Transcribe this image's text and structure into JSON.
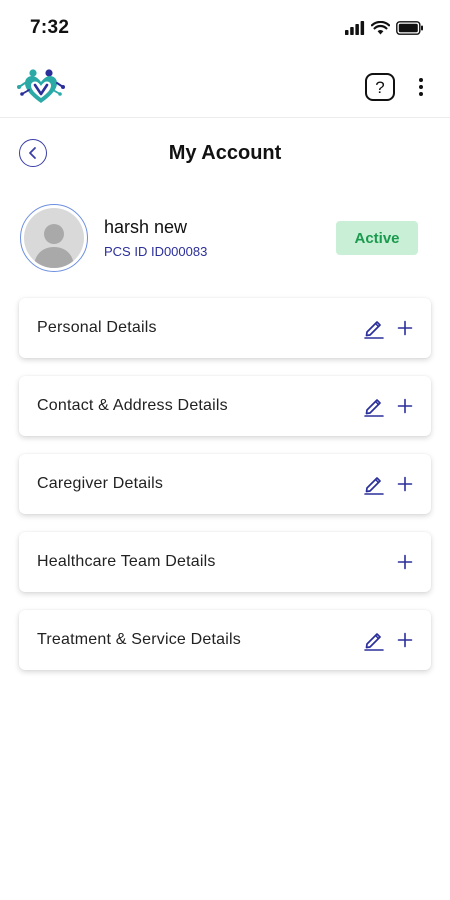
{
  "status_bar": {
    "time": "7:32"
  },
  "header": {
    "help_symbol": "?"
  },
  "page": {
    "title": "My Account"
  },
  "profile": {
    "name": "harsh new",
    "pcs_id": "PCS ID ID000083",
    "status": "Active"
  },
  "sections": [
    {
      "label": "Personal Details",
      "editable": true
    },
    {
      "label": "Contact & Address Details",
      "editable": true
    },
    {
      "label": "Caregiver Details",
      "editable": true
    },
    {
      "label": "Healthcare Team Details",
      "editable": false
    },
    {
      "label": "Treatment & Service Details",
      "editable": true
    }
  ],
  "colors": {
    "accent": "#2b2f9a",
    "badge_bg": "#c9f0d6",
    "badge_text": "#1a9a4e",
    "logo_teal": "#2aa9a7"
  }
}
